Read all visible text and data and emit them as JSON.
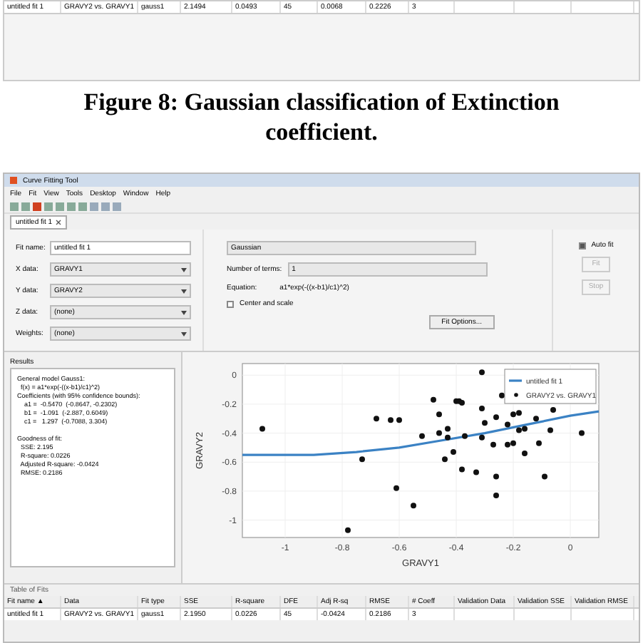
{
  "top_table": {
    "row": [
      "untitled fit 1",
      "GRAVY2 vs. GRAVY1",
      "gauss1",
      "2.1494",
      "0.0493",
      "45",
      "0.0068",
      "0.2226",
      "3"
    ]
  },
  "caption": "Figure 8: Gaussian classification of Extinction coefficient.",
  "window": {
    "title": "Curve Fitting Tool"
  },
  "menu": [
    "File",
    "Fit",
    "View",
    "Tools",
    "Desktop",
    "Window",
    "Help"
  ],
  "tabs": [
    {
      "label": "untitled fit 1",
      "selected": true
    }
  ],
  "fields": [
    {
      "label": "Fit name:",
      "value": "untitled fit 1",
      "kind": "text"
    },
    {
      "label": "X data:",
      "value": "GRAVY1",
      "kind": "select"
    },
    {
      "label": "Y data:",
      "value": "GRAVY2",
      "kind": "select"
    },
    {
      "label": "Z data:",
      "value": "(none)",
      "kind": "select"
    },
    {
      "label": "Weights:",
      "value": "(none)",
      "kind": "select"
    }
  ],
  "model": {
    "type": "Gaussian",
    "terms_label": "Number of terms:",
    "terms": "1",
    "equation_label": "Equation:",
    "equation": "a1*exp(-((x-b1)/c1)^2)",
    "center_scale": {
      "label": "Center and scale",
      "checked": false
    },
    "options_button": "Fit Options..."
  },
  "auto_fit": {
    "label": "Auto fit",
    "checked": true
  },
  "actions": [
    {
      "label": "Fit",
      "disabled": true
    },
    {
      "label": "Stop",
      "disabled": true
    }
  ],
  "results": {
    "title": "Results",
    "sections": [
      [
        "General model Gauss1:",
        "  f(x) = a1*exp(-((x-b1)/c1)^2)",
        "Coefficients (with 95% confidence bounds):",
        "    a1 =  -0.5470  (-0.8647, -0.2302)",
        "    b1 =  -1.091  (-2.887, 0.6049)",
        "    c1 =   1.297  (-0.7088, 3.304)"
      ],
      [
        "Goodness of fit:",
        "  SSE: 2.195",
        "  R-square: 0.0226",
        "  Adjusted R-square: -0.0424",
        "  RMSE: 0.2186"
      ]
    ]
  },
  "chart_data": {
    "type": "scatter",
    "xlabel": "GRAVY1",
    "ylabel": "GRAVY2",
    "grid": true,
    "xlim": [
      -1.15,
      0.1
    ],
    "ylim": [
      -1.12,
      0.08
    ],
    "xticks": [
      -1,
      -0.8,
      -0.6,
      -0.4,
      -0.2,
      0
    ],
    "yticks": [
      0,
      -0.2,
      -0.4,
      -0.6,
      -0.8,
      -1
    ],
    "series": [
      {
        "name": "untitled fit 1",
        "color": "#3b82c4",
        "type": "line",
        "x": [
          -1.15,
          -0.9,
          -0.75,
          -0.6,
          -0.45,
          -0.3,
          -0.15,
          0,
          0.1
        ],
        "values": [
          -0.55,
          -0.55,
          -0.53,
          -0.5,
          -0.45,
          -0.4,
          -0.34,
          -0.28,
          -0.25
        ]
      },
      {
        "name": "GRAVY2 vs. GRAVY1",
        "color": "#111111",
        "x": [
          -1.08,
          -0.68,
          -0.63,
          -0.6,
          -0.48,
          -0.46,
          -0.52,
          -0.46,
          -0.43,
          -0.43,
          -0.4,
          -0.39,
          -0.38,
          -0.37,
          -0.31,
          -0.31,
          -0.3,
          -0.31,
          -0.26,
          -0.24,
          -0.22,
          -0.2,
          -0.18,
          -0.18,
          -0.16,
          -0.12,
          -0.11,
          -0.06,
          -0.07,
          0.04,
          -0.27,
          -0.22,
          -0.2,
          -0.16,
          -0.44,
          -0.41,
          -0.73,
          -0.38,
          -0.33,
          -0.26,
          -0.09,
          -0.61,
          -0.26,
          -0.55,
          -0.78
        ],
        "values": [
          -0.37,
          -0.3,
          -0.31,
          -0.31,
          -0.17,
          -0.27,
          -0.42,
          -0.4,
          -0.37,
          -0.43,
          -0.18,
          -0.18,
          -0.19,
          -0.42,
          0.02,
          -0.23,
          -0.33,
          -0.43,
          -0.29,
          -0.14,
          -0.34,
          -0.27,
          -0.26,
          -0.38,
          -0.37,
          -0.3,
          -0.47,
          -0.24,
          -0.38,
          -0.4,
          -0.48,
          -0.48,
          -0.47,
          -0.54,
          -0.58,
          -0.53,
          -0.58,
          -0.65,
          -0.67,
          -0.7,
          -0.7,
          -0.78,
          -0.83,
          -0.9,
          -1.07
        ]
      }
    ]
  },
  "table_of_fits": {
    "title": "Table of Fits",
    "columns": [
      "Fit name ▲",
      "Data",
      "Fit type",
      "SSE",
      "R-square",
      "DFE",
      "Adj R-sq",
      "RMSE",
      "# Coeff",
      "Validation Data",
      "Validation SSE",
      "Validation RMSE"
    ],
    "rows": [
      {
        "cells": [
          "untitled fit 1",
          "GRAVY2 vs. GRAVY1",
          "gauss1",
          "2.1950",
          "0.0226",
          "45",
          "-0.0424",
          "0.2186",
          "3"
        ],
        "selected": false
      }
    ]
  }
}
